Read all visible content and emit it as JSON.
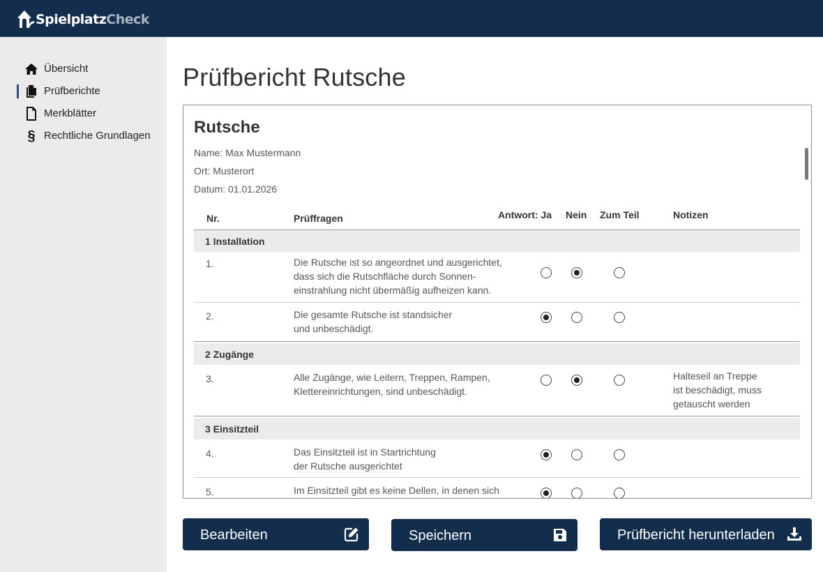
{
  "app": {
    "brand_part1": "Spielplatz",
    "brand_part2": "Check",
    "accent_color": "#132d4c"
  },
  "sidebar": {
    "items": [
      {
        "label": "Übersicht",
        "icon": "home-icon",
        "active": false
      },
      {
        "label": "Prüfberichte",
        "icon": "documents-icon",
        "active": true
      },
      {
        "label": "Merkblätter",
        "icon": "document-icon",
        "active": false
      },
      {
        "label": "Rechtliche Grundlagen",
        "icon": "paragraph-icon",
        "active": false
      }
    ],
    "paragraph_glyph": "§"
  },
  "page": {
    "title": "Prüfbericht Rutsche"
  },
  "report": {
    "title": "Rutsche",
    "name": "Name: Max Mustermann",
    "ort": "Ort: Musterort",
    "datum": "Datum: 01.01.2026",
    "columns": {
      "nr": "Nr.",
      "question": "Prüffragen",
      "yes": "Antwort: Ja",
      "no": "Nein",
      "partial": "Zum Teil",
      "notes": "Notizen"
    },
    "sections": [
      {
        "title": "1 Installation"
      },
      {
        "title": "2 Zugänge"
      },
      {
        "title": "3 Einsitzteil"
      }
    ],
    "rows": [
      {
        "nr": "1.",
        "lines": [
          "Die Rutsche ist so angeordnet und ausgerichtet,",
          "dass sich die Rutschfläche durch Sonnen-",
          "einstrahlung nicht übermäßig aufheizen kann."
        ],
        "answer": "no",
        "note_lines": []
      },
      {
        "nr": "2.",
        "lines": [
          "Die gesamte Rutsche ist standsicher",
          "und unbeschädigt."
        ],
        "answer": "yes",
        "note_lines": []
      },
      {
        "nr": "3.",
        "lines": [
          "Alle Zugänge, wie Leitern, Treppen, Rampen,",
          "Klettereinrichtungen, sind unbeschädigt."
        ],
        "answer": "no",
        "note_lines": [
          "Halteseil an Treppe",
          "ist beschädigt, muss",
          "getauscht werden"
        ]
      },
      {
        "nr": "4.",
        "lines": [
          "Das Einsitzteil ist in Startrichtung",
          "der Rutsche ausgerichtet"
        ],
        "answer": "yes",
        "note_lines": []
      },
      {
        "nr": "5.",
        "lines": [
          "Im Einsitzteil gibt es keine Dellen, in denen sich"
        ],
        "answer": "yes",
        "note_lines": []
      }
    ]
  },
  "buttons": {
    "edit": {
      "label": "Bearbeiten",
      "icon": "edit-icon"
    },
    "save": {
      "label": "Speichern",
      "icon": "floppy-disk-icon"
    },
    "download": {
      "label": "Prüfbericht herunterladen",
      "icon": "download-icon"
    }
  }
}
